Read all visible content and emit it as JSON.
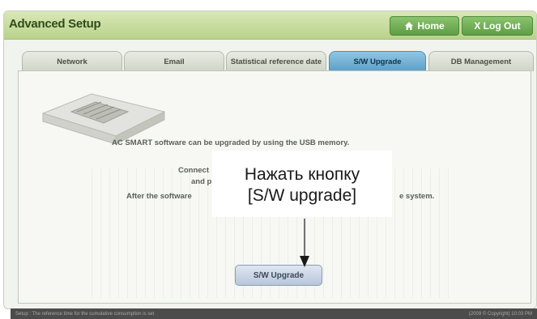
{
  "header": {
    "title": "Advanced Setup",
    "home_label": "Home",
    "logout_label": "X Log Out"
  },
  "tabs": [
    {
      "label": "Network"
    },
    {
      "label": "Email"
    },
    {
      "label": "Statistical reference date"
    },
    {
      "label": "S/W Upgrade"
    },
    {
      "label": "DB Management"
    }
  ],
  "content": {
    "line1": "AC SMART software can be upgraded by using the USB memory.",
    "line2": "Connect",
    "line3": "and pre",
    "line4_left": "After the software",
    "line4_right": "e system.",
    "button_label": "S/W Upgrade"
  },
  "callout": {
    "line1": "Нажать кнопку",
    "line2": "[S/W upgrade]"
  },
  "statusbar": {
    "left_text": "Setup : The reference time for the cumulative consumption is set",
    "right_text": "(2009 © Copyright) 10:03 PM"
  },
  "colors": {
    "titlebar": "#c6dda0",
    "active_tab": "#6faed3",
    "header_button": "#6fae55"
  }
}
